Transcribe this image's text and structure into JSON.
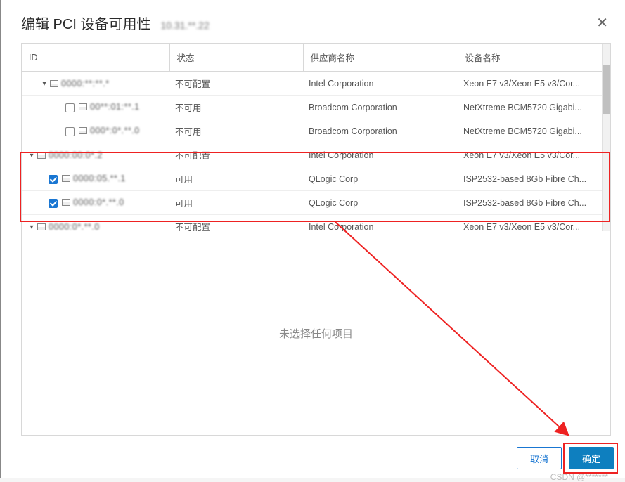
{
  "dialog": {
    "title": "编辑 PCI 设备可用性",
    "subtitle_obscured": "10.31.**.22",
    "close_glyph": "✕"
  },
  "columns": {
    "id": "ID",
    "state": "状态",
    "vendor": "供应商名称",
    "device": "设备名称"
  },
  "rows": [
    {
      "expand": "▾",
      "checkbox": null,
      "indent": 1,
      "id_text": "0000:**:**.*",
      "id_blur": true,
      "state": "不可配置",
      "vendor": "Intel Corporation",
      "device": "Xeon E7 v3/Xeon E5 v3/Cor..."
    },
    {
      "expand": "",
      "checkbox": false,
      "indent": 2,
      "id_text": "00**:01:**.1",
      "id_blur": true,
      "state": "不可用",
      "vendor": "Broadcom Corporation",
      "device": "NetXtreme BCM5720 Gigabi..."
    },
    {
      "expand": "",
      "checkbox": false,
      "indent": 2,
      "id_text": "000*:0*.**.0",
      "id_blur": true,
      "state": "不可用",
      "vendor": "Broadcom Corporation",
      "device": "NetXtreme BCM5720 Gigabi..."
    },
    {
      "expand": "▾",
      "checkbox": null,
      "indent": 0,
      "id_text": "0000:00:0*.2",
      "id_blur": true,
      "state": "不可配置",
      "vendor": "Intel Corporation",
      "device": "Xeon E7 v3/Xeon E5 v3/Cor..."
    },
    {
      "expand": "",
      "checkbox": true,
      "indent": 1,
      "id_text": "0000:05.**.1",
      "id_blur": true,
      "state": "可用",
      "vendor": "QLogic Corp",
      "device": "ISP2532-based 8Gb Fibre Ch..."
    },
    {
      "expand": "",
      "checkbox": true,
      "indent": 1,
      "id_text": "0000:0*.**.0",
      "id_blur": true,
      "state": "可用",
      "vendor": "QLogic Corp",
      "device": "ISP2532-based 8Gb Fibre Ch..."
    },
    {
      "expand": "▾",
      "checkbox": null,
      "indent": 0,
      "id_text": "0000:0*.**.0",
      "id_blur": true,
      "state": "不可配置",
      "vendor": "Intel Corporation",
      "device": "Xeon E7 v3/Xeon E5 v3/Cor..."
    }
  ],
  "empty_message": "未选择任何项目",
  "footer": {
    "cancel": "取消",
    "ok": "确定"
  },
  "watermark_hint": "CSDN @*******"
}
